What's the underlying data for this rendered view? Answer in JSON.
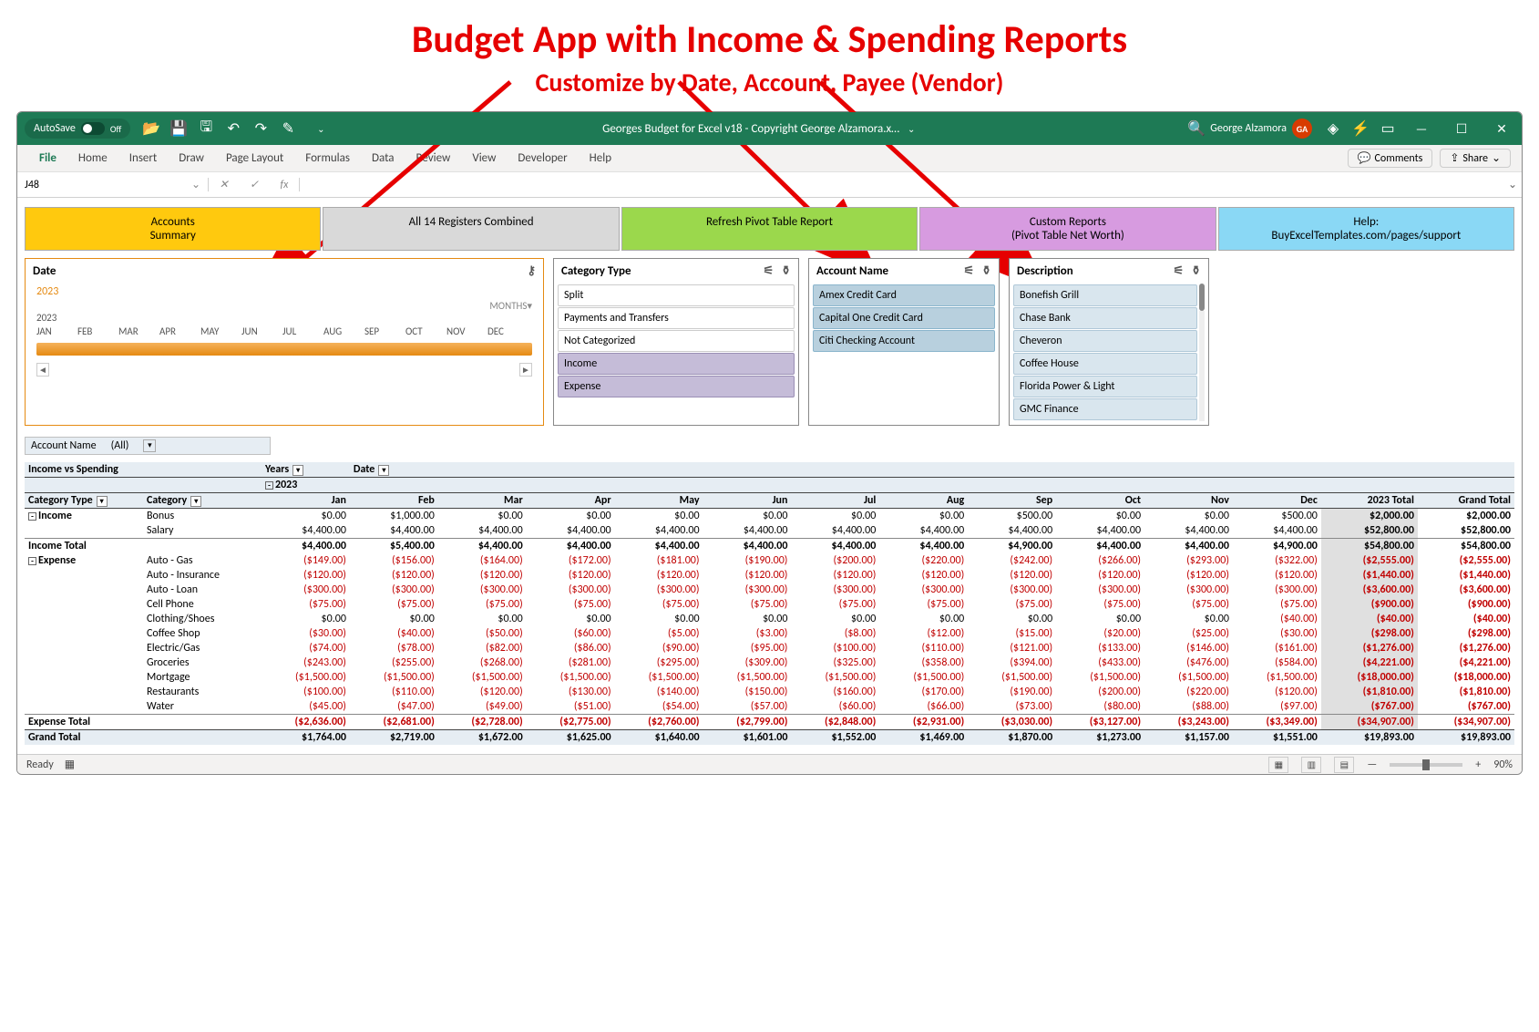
{
  "headline": {
    "title": "Budget App with Income & Spending Reports",
    "subtitle": "Customize by Date, Account, Payee (Vendor)"
  },
  "titlebar": {
    "autosave_label": "AutoSave",
    "autosave_state": "Off",
    "doc_title": "Georges Budget for Excel v18 - Copyright George Alzamora.x…",
    "user_name": "George Alzamora",
    "user_initials": "GA"
  },
  "ribbon": {
    "tabs": [
      "File",
      "Home",
      "Insert",
      "Draw",
      "Page Layout",
      "Formulas",
      "Data",
      "Review",
      "View",
      "Developer",
      "Help"
    ],
    "comments": "Comments",
    "share": "Share"
  },
  "formula_bar": {
    "name_box": "J48",
    "fx_value": ""
  },
  "nav_buttons": [
    {
      "label": "Accounts\nSummary",
      "class": "gold"
    },
    {
      "label": "All 14 Registers Combined",
      "class": "gray"
    },
    {
      "label": "Refresh Pivot Table Report",
      "class": "green"
    },
    {
      "label": "Custom Reports\n(Pivot Table Net Worth)",
      "class": "magenta"
    },
    {
      "label": "Help:\nBuyExcelTemplates.com/pages/support",
      "class": "blue"
    }
  ],
  "date_slicer": {
    "title": "Date",
    "year_selected": "2023",
    "year_below": "2023",
    "period_label": "MONTHS",
    "months": [
      "JAN",
      "FEB",
      "MAR",
      "APR",
      "MAY",
      "JUN",
      "JUL",
      "AUG",
      "SEP",
      "OCT",
      "NOV",
      "DEC"
    ]
  },
  "slicers": {
    "category_type": {
      "title": "Category Type",
      "items": [
        {
          "label": "Split",
          "sel": false
        },
        {
          "label": "Payments and Transfers",
          "sel": false
        },
        {
          "label": "Not Categorized",
          "sel": false
        },
        {
          "label": "Income",
          "sel": true
        },
        {
          "label": "Expense",
          "sel": true
        }
      ]
    },
    "account_name": {
      "title": "Account Name",
      "items": [
        {
          "label": "Amex Credit Card",
          "sel": true
        },
        {
          "label": "Capital One Credit Card",
          "sel": true
        },
        {
          "label": "Citi Checking Account",
          "sel": true
        }
      ]
    },
    "description": {
      "title": "Description",
      "items": [
        {
          "label": "Bonefish Grill",
          "sel": true
        },
        {
          "label": "Chase Bank",
          "sel": true
        },
        {
          "label": "Cheveron",
          "sel": true
        },
        {
          "label": "Coffee House",
          "sel": true
        },
        {
          "label": "Florida Power & Light",
          "sel": true
        },
        {
          "label": "GMC Finance",
          "sel": true
        }
      ]
    }
  },
  "account_filter": {
    "label": "Account Name",
    "value": "(All)"
  },
  "pivot_headers": {
    "title": "Income vs Spending",
    "years": "Years",
    "date": "Date",
    "year": "2023",
    "cat_type": "Category Type",
    "category": "Category",
    "months": [
      "Jan",
      "Feb",
      "Mar",
      "Apr",
      "May",
      "Jun",
      "Jul",
      "Aug",
      "Sep",
      "Oct",
      "Nov",
      "Dec"
    ],
    "total_2023": "2023 Total",
    "grand_total": "Grand Total"
  },
  "pivot": {
    "income": {
      "label": "Income",
      "rows": [
        {
          "cat": "Bonus",
          "vals": [
            "$0.00",
            "$1,000.00",
            "$0.00",
            "$0.00",
            "$0.00",
            "$0.00",
            "$0.00",
            "$0.00",
            "$500.00",
            "$0.00",
            "$0.00",
            "$500.00"
          ],
          "t": "$2,000.00",
          "g": "$2,000.00"
        },
        {
          "cat": "Salary",
          "vals": [
            "$4,400.00",
            "$4,400.00",
            "$4,400.00",
            "$4,400.00",
            "$4,400.00",
            "$4,400.00",
            "$4,400.00",
            "$4,400.00",
            "$4,400.00",
            "$4,400.00",
            "$4,400.00",
            "$4,400.00"
          ],
          "t": "$52,800.00",
          "g": "$52,800.00"
        }
      ],
      "total": {
        "label": "Income Total",
        "vals": [
          "$4,400.00",
          "$5,400.00",
          "$4,400.00",
          "$4,400.00",
          "$4,400.00",
          "$4,400.00",
          "$4,400.00",
          "$4,400.00",
          "$4,900.00",
          "$4,400.00",
          "$4,400.00",
          "$4,900.00"
        ],
        "t": "$54,800.00",
        "g": "$54,800.00"
      }
    },
    "expense": {
      "label": "Expense",
      "rows": [
        {
          "cat": "Auto - Gas",
          "vals": [
            "($149.00)",
            "($156.00)",
            "($164.00)",
            "($172.00)",
            "($181.00)",
            "($190.00)",
            "($200.00)",
            "($220.00)",
            "($242.00)",
            "($266.00)",
            "($293.00)",
            "($322.00)"
          ],
          "t": "($2,555.00)",
          "g": "($2,555.00)"
        },
        {
          "cat": "Auto - Insurance",
          "vals": [
            "($120.00)",
            "($120.00)",
            "($120.00)",
            "($120.00)",
            "($120.00)",
            "($120.00)",
            "($120.00)",
            "($120.00)",
            "($120.00)",
            "($120.00)",
            "($120.00)",
            "($120.00)"
          ],
          "t": "($1,440.00)",
          "g": "($1,440.00)"
        },
        {
          "cat": "Auto - Loan",
          "vals": [
            "($300.00)",
            "($300.00)",
            "($300.00)",
            "($300.00)",
            "($300.00)",
            "($300.00)",
            "($300.00)",
            "($300.00)",
            "($300.00)",
            "($300.00)",
            "($300.00)",
            "($300.00)"
          ],
          "t": "($3,600.00)",
          "g": "($3,600.00)"
        },
        {
          "cat": "Cell Phone",
          "vals": [
            "($75.00)",
            "($75.00)",
            "($75.00)",
            "($75.00)",
            "($75.00)",
            "($75.00)",
            "($75.00)",
            "($75.00)",
            "($75.00)",
            "($75.00)",
            "($75.00)",
            "($75.00)"
          ],
          "t": "($900.00)",
          "g": "($900.00)"
        },
        {
          "cat": "Clothing/Shoes",
          "vals": [
            "$0.00",
            "$0.00",
            "$0.00",
            "$0.00",
            "$0.00",
            "$0.00",
            "$0.00",
            "$0.00",
            "$0.00",
            "$0.00",
            "$0.00",
            "($40.00)"
          ],
          "t": "($40.00)",
          "g": "($40.00)"
        },
        {
          "cat": "Coffee Shop",
          "vals": [
            "($30.00)",
            "($40.00)",
            "($50.00)",
            "($60.00)",
            "($5.00)",
            "($3.00)",
            "($8.00)",
            "($12.00)",
            "($15.00)",
            "($20.00)",
            "($25.00)",
            "($30.00)"
          ],
          "t": "($298.00)",
          "g": "($298.00)"
        },
        {
          "cat": "Electric/Gas",
          "vals": [
            "($74.00)",
            "($78.00)",
            "($82.00)",
            "($86.00)",
            "($90.00)",
            "($95.00)",
            "($100.00)",
            "($110.00)",
            "($121.00)",
            "($133.00)",
            "($146.00)",
            "($161.00)"
          ],
          "t": "($1,276.00)",
          "g": "($1,276.00)"
        },
        {
          "cat": "Groceries",
          "vals": [
            "($243.00)",
            "($255.00)",
            "($268.00)",
            "($281.00)",
            "($295.00)",
            "($309.00)",
            "($325.00)",
            "($358.00)",
            "($394.00)",
            "($433.00)",
            "($476.00)",
            "($584.00)"
          ],
          "t": "($4,221.00)",
          "g": "($4,221.00)"
        },
        {
          "cat": "Mortgage",
          "vals": [
            "($1,500.00)",
            "($1,500.00)",
            "($1,500.00)",
            "($1,500.00)",
            "($1,500.00)",
            "($1,500.00)",
            "($1,500.00)",
            "($1,500.00)",
            "($1,500.00)",
            "($1,500.00)",
            "($1,500.00)",
            "($1,500.00)"
          ],
          "t": "($18,000.00)",
          "g": "($18,000.00)"
        },
        {
          "cat": "Restaurants",
          "vals": [
            "($100.00)",
            "($110.00)",
            "($120.00)",
            "($130.00)",
            "($140.00)",
            "($150.00)",
            "($160.00)",
            "($170.00)",
            "($190.00)",
            "($200.00)",
            "($220.00)",
            "($120.00)"
          ],
          "t": "($1,810.00)",
          "g": "($1,810.00)"
        },
        {
          "cat": "Water",
          "vals": [
            "($45.00)",
            "($47.00)",
            "($49.00)",
            "($51.00)",
            "($54.00)",
            "($57.00)",
            "($60.00)",
            "($66.00)",
            "($73.00)",
            "($80.00)",
            "($88.00)",
            "($97.00)"
          ],
          "t": "($767.00)",
          "g": "($767.00)"
        }
      ],
      "total": {
        "label": "Expense Total",
        "vals": [
          "($2,636.00)",
          "($2,681.00)",
          "($2,728.00)",
          "($2,775.00)",
          "($2,760.00)",
          "($2,799.00)",
          "($2,848.00)",
          "($2,931.00)",
          "($3,030.00)",
          "($3,127.00)",
          "($3,243.00)",
          "($3,349.00)"
        ],
        "t": "($34,907.00)",
        "g": "($34,907.00)"
      }
    },
    "grand_total": {
      "label": "Grand Total",
      "vals": [
        "$1,764.00",
        "$2,719.00",
        "$1,672.00",
        "$1,625.00",
        "$1,640.00",
        "$1,601.00",
        "$1,552.00",
        "$1,469.00",
        "$1,870.00",
        "$1,273.00",
        "$1,157.00",
        "$1,551.00"
      ],
      "t": "$19,893.00",
      "g": "$19,893.00"
    }
  },
  "status_bar": {
    "ready": "Ready",
    "zoom": "90%"
  }
}
